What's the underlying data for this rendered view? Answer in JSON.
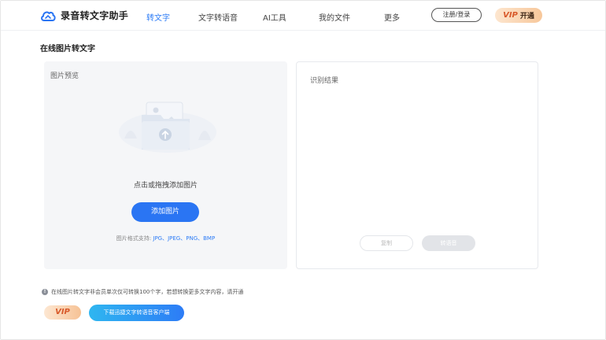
{
  "header": {
    "app_name": "录音转文字助手",
    "nav": [
      "转文字",
      "文字转语音",
      "AI工具",
      "我的文件",
      "更多"
    ],
    "login_label": "注册/登录",
    "vip_word": "VIP",
    "vip_action": "开通"
  },
  "page": {
    "title": "在线图片转文字"
  },
  "left_panel": {
    "title": "图片预览",
    "drop_hint": "点击或拖拽添加图片",
    "add_button": "添加图片",
    "formats_prefix": "图片格式支持:",
    "formats": "JPG、JPEG、PNG、BMP"
  },
  "right_panel": {
    "title": "识别结果",
    "copy_button": "复制",
    "tts_button": "转语音"
  },
  "footer": {
    "notice": "在线图片转文字非会员单次仅可转换100个字，若想转换更多文字内容，请开通",
    "vip_badge": "VIP",
    "download_button": "下载迅捷文字转语音客户端"
  },
  "colors": {
    "accent": "#2a75f3",
    "vip_gradient_start": "#fde6cf",
    "vip_gradient_end": "#f7c79a"
  }
}
